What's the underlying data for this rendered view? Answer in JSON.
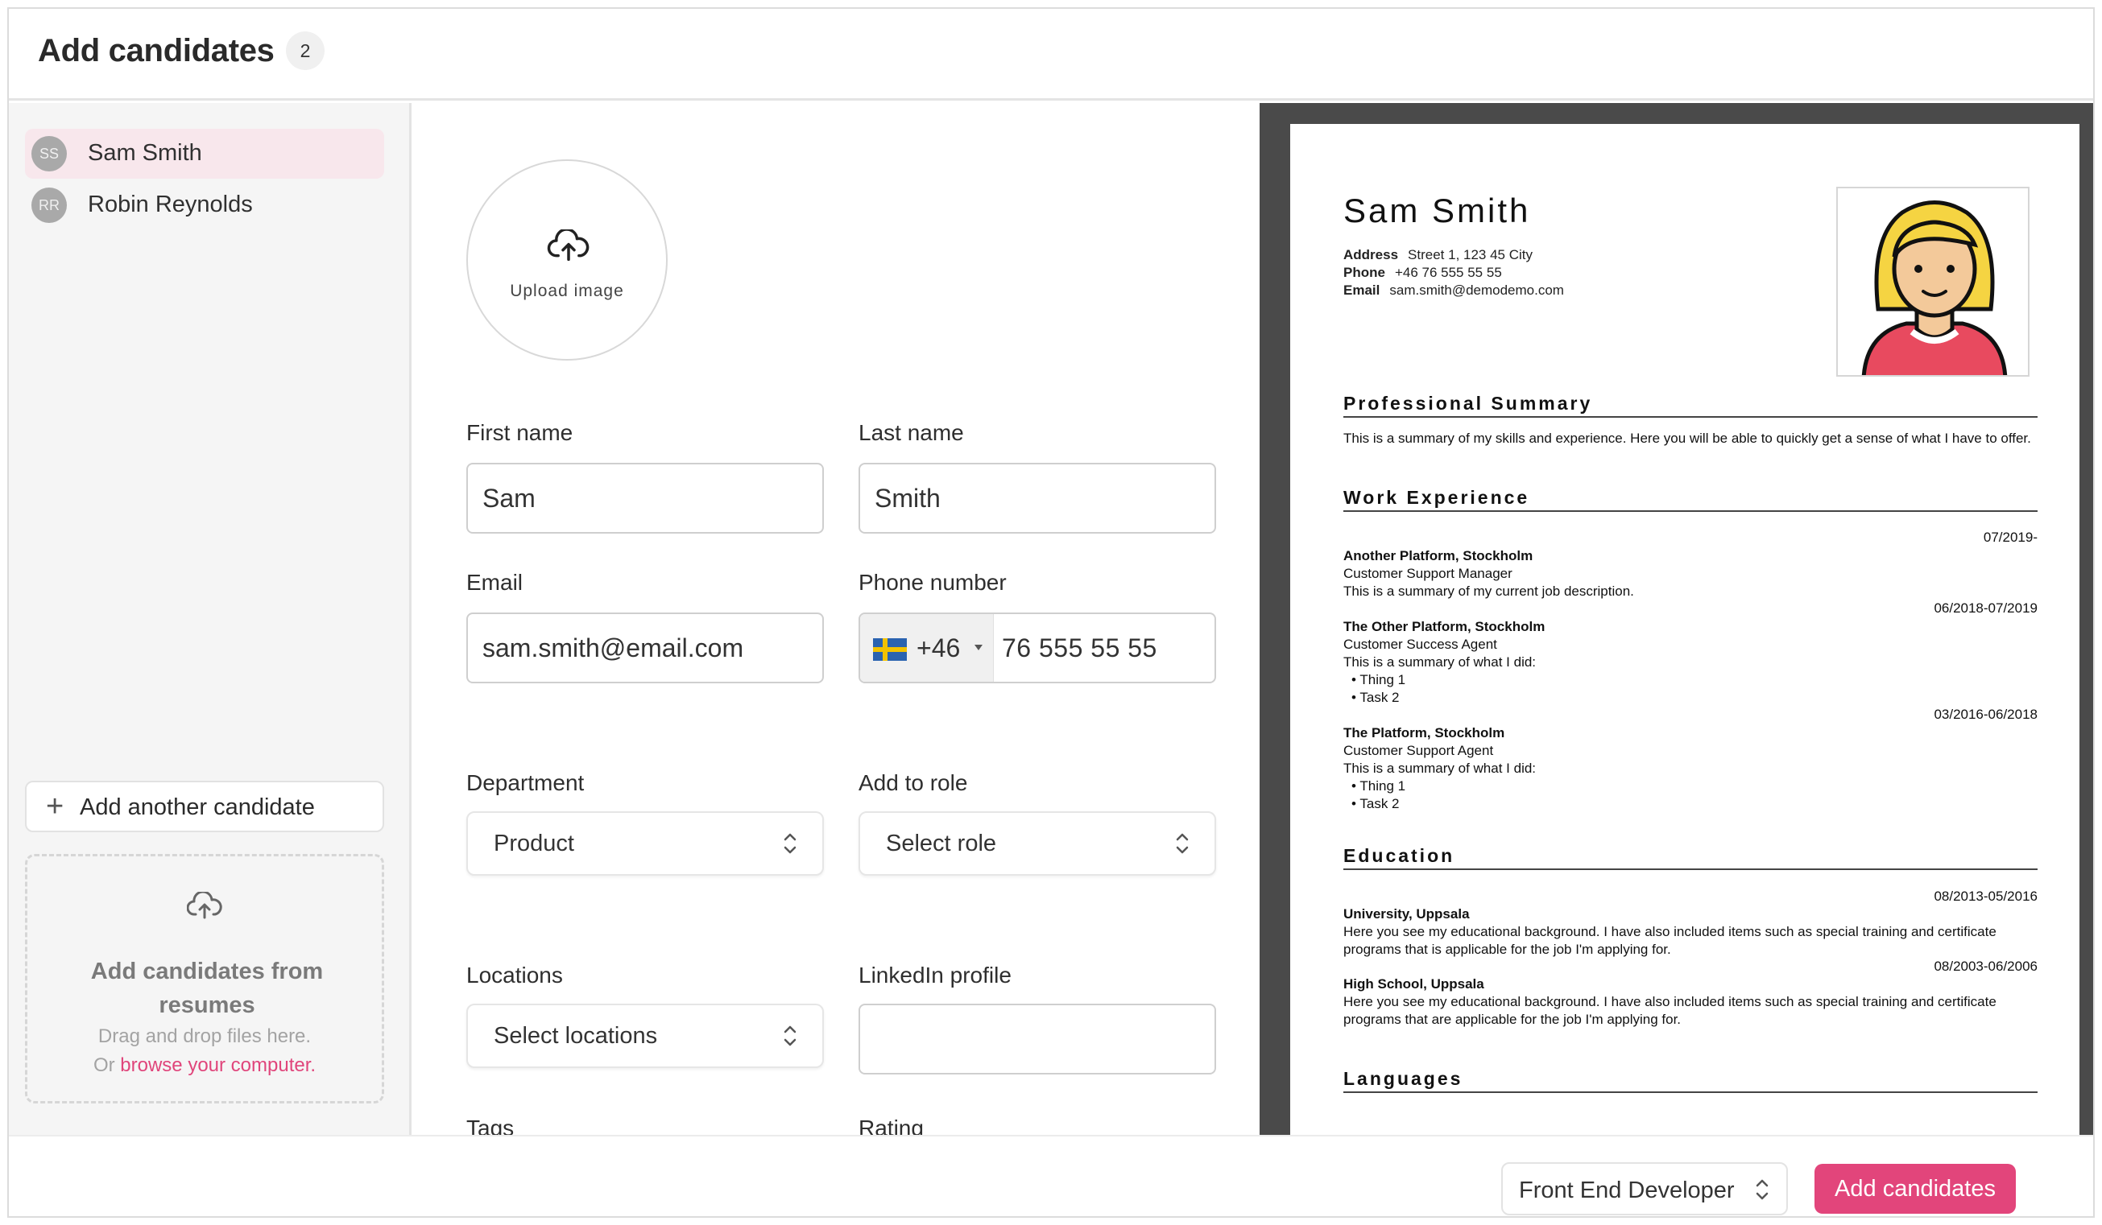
{
  "header": {
    "title": "Add candidates",
    "count": "2"
  },
  "sidebar": {
    "candidates": [
      {
        "initials": "SS",
        "name": "Sam Smith",
        "active": true
      },
      {
        "initials": "RR",
        "name": "Robin Reynolds",
        "active": false
      }
    ],
    "add_another_label": "Add another candidate",
    "dropzone": {
      "title": "Add candidates from resumes",
      "subtitle": "Drag and drop files here.",
      "or_text": "Or",
      "link_text": "browse your computer."
    }
  },
  "form": {
    "upload_label": "Upload image",
    "first_name": {
      "label": "First name",
      "value": "Sam"
    },
    "last_name": {
      "label": "Last name",
      "value": "Smith"
    },
    "email": {
      "label": "Email",
      "value": "sam.smith@email.com"
    },
    "phone": {
      "label": "Phone number",
      "country_code": "+46",
      "country": "Sweden",
      "value": "76 555 55 55"
    },
    "department": {
      "label": "Department",
      "value": "Product"
    },
    "role": {
      "label": "Add to role",
      "placeholder": "Select role"
    },
    "locations": {
      "label": "Locations",
      "placeholder": "Select locations"
    },
    "linkedin": {
      "label": "LinkedIn profile",
      "value": ""
    },
    "tags": {
      "label": "Tags"
    },
    "rating": {
      "label": "Rating"
    }
  },
  "resume": {
    "name": "Sam Smith",
    "address_label": "Address",
    "address": "Street 1, 123 45 City",
    "phone_label": "Phone",
    "phone": "+46 76 555 55 55",
    "email_label": "Email",
    "email": "sam.smith@demodemo.com",
    "summary_heading": "Professional Summary",
    "summary": "This is a summary of my skills and experience. Here you will be able to quickly get a sense of what I have to offer.",
    "work_heading": "Work Experience",
    "jobs": [
      {
        "date": "07/2019-",
        "company": "Another Platform, Stockholm",
        "title": "Customer Support Manager",
        "desc": "This is a summary of my current job description.",
        "bullets": []
      },
      {
        "date": "06/2018-07/2019",
        "company": "The Other Platform, Stockholm",
        "title": "Customer Success Agent",
        "desc": "This is a summary of what I did:",
        "bullets": [
          "• Thing 1",
          "• Task 2"
        ]
      },
      {
        "date": "03/2016-06/2018",
        "company": "The Platform, Stockholm",
        "title": "Customer Support Agent",
        "desc": "This is a summary of what I did:",
        "bullets": [
          "• Thing 1",
          "• Task 2"
        ]
      }
    ],
    "education_heading": "Education",
    "education": [
      {
        "date": "08/2013-05/2016",
        "school": "University, Uppsala",
        "line1": "Here you see my educational background. I have also included items such as special training and certificate",
        "line2": "programs that is applicable for the job I'm applying for."
      },
      {
        "date": "08/2003-06/2006",
        "school": "High School, Uppsala",
        "line1": "Here you see my educational background. I have also included items such as special training and certificate",
        "line2": "programs that are applicable for the job I'm applying for."
      }
    ],
    "languages_heading": "Languages"
  },
  "footer": {
    "role_value": "Front End Developer",
    "submit_label": "Add candidates"
  },
  "colors": {
    "accent": "#e2457b",
    "active_item_bg": "#f8e7ec",
    "preview_bg": "#4a4a4a"
  }
}
